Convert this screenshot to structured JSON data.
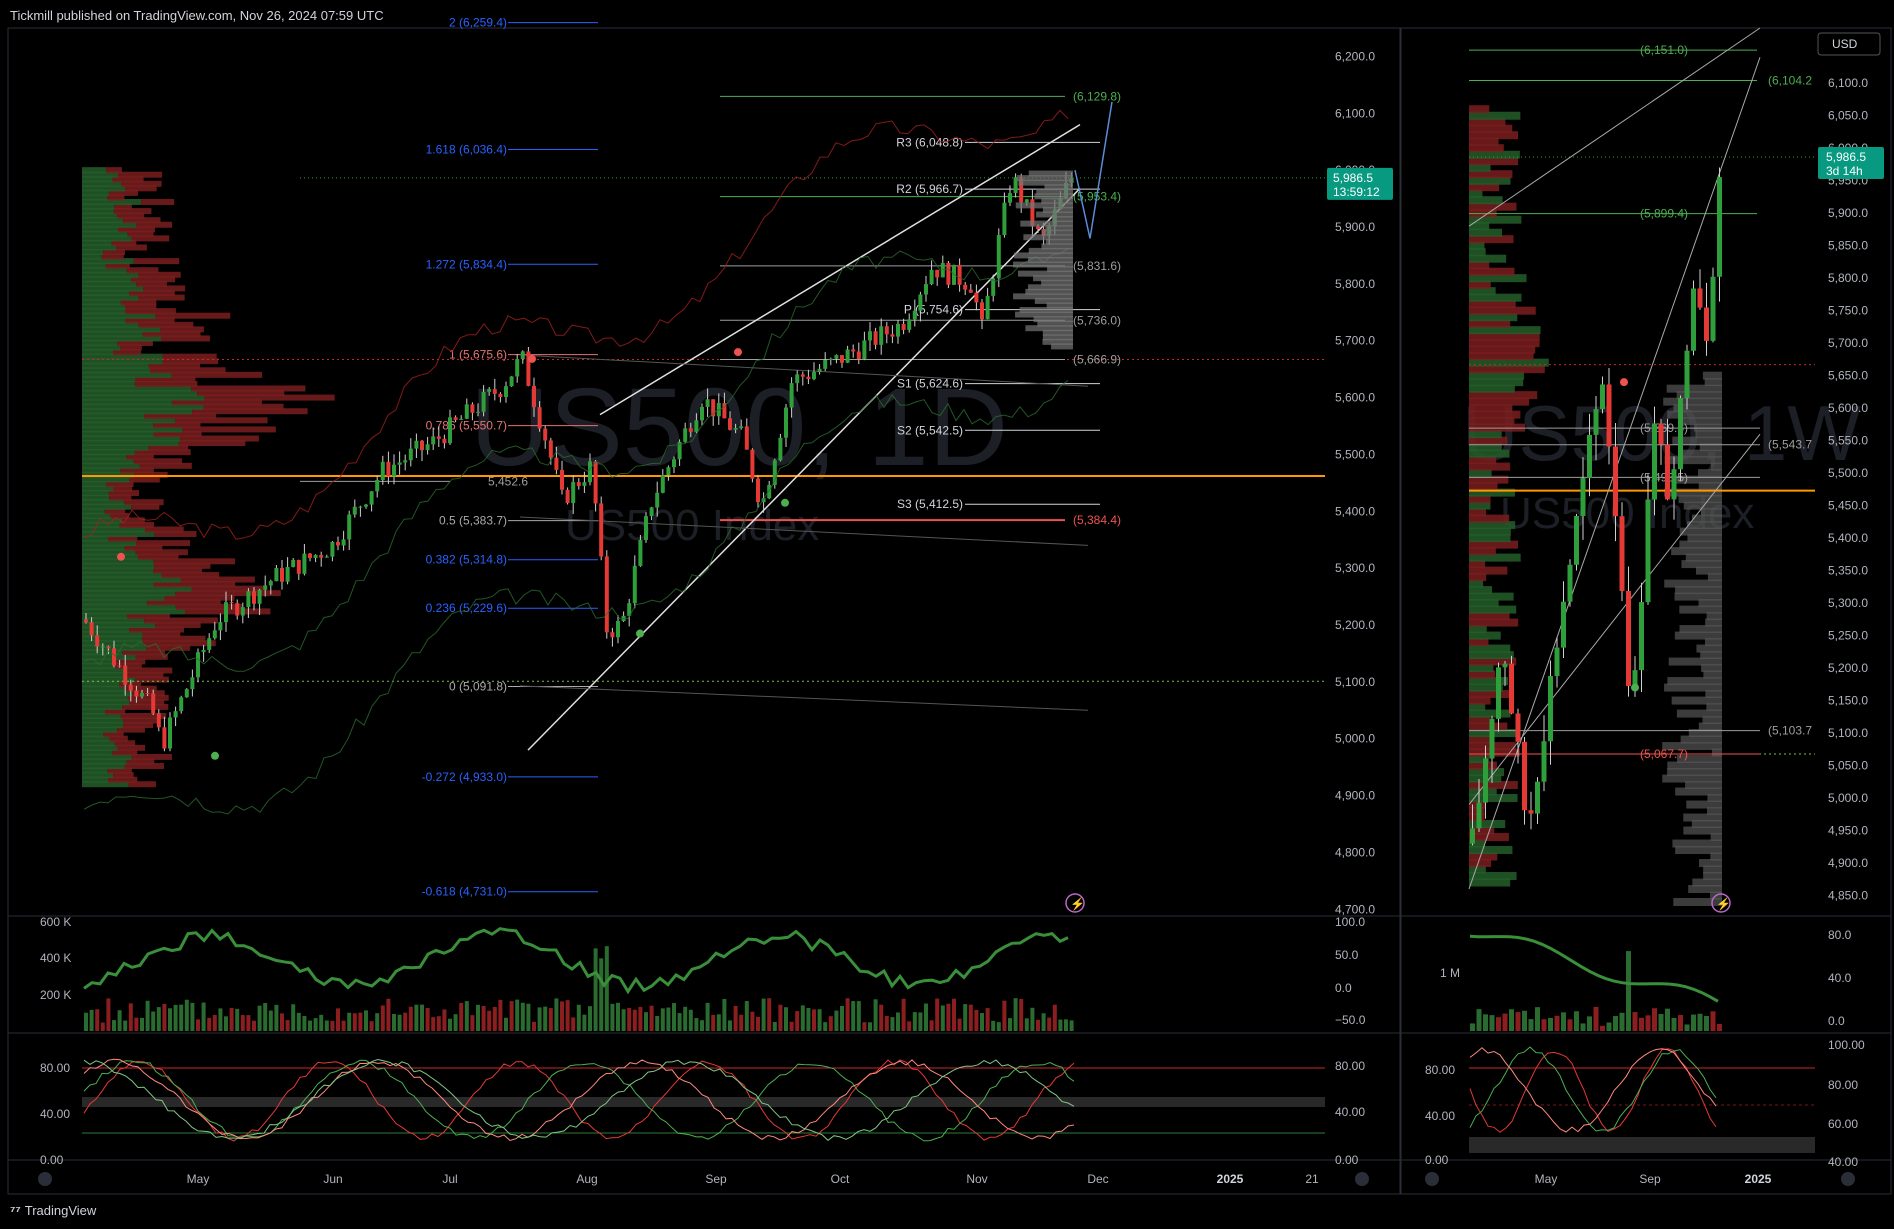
{
  "header": {
    "published": "Tickmill published on TradingView.com, Nov 26, 2024 07:59 UTC"
  },
  "footer": {
    "logo_text": "TradingView"
  },
  "colors": {
    "bull": "#2e9f3a",
    "bear": "#c62828",
    "fib": "#2962ff",
    "orange": "#ff9800",
    "panel_line": "#2a2e39",
    "price_badge": "#089981"
  },
  "chart_data": [
    {
      "type": "line",
      "name": "daily",
      "watermark_symbol": "US500, 1D",
      "watermark_desc": "US500 Index",
      "price_axis_ticks": [
        "6,200.0",
        "6,100.0",
        "6,000.0",
        "5,900.0",
        "5,800.0",
        "5,700.0",
        "5,600.0",
        "5,500.0",
        "5,400.0",
        "5,300.0",
        "5,200.0",
        "5,100.0",
        "5,000.0",
        "4,900.0",
        "4,800.0",
        "4,700.0"
      ],
      "ylim": [
        4690,
        6250
      ],
      "price_tag": {
        "value": "5,986.5",
        "timer": "13:59:12"
      },
      "time_axis_labels": [
        "May",
        "Jun",
        "Jul",
        "Aug",
        "Sep",
        "Oct",
        "Nov",
        "Dec",
        "2025",
        "21"
      ],
      "fib_levels": [
        {
          "label": "2 (6,259.4)",
          "price": 6259.4
        },
        {
          "label": "1.618 (6,036.4)",
          "price": 6036.4
        },
        {
          "label": "1.272 (5,834.4)",
          "price": 5834.4
        },
        {
          "label": "1 (5,675.6)",
          "price": 5675.6
        },
        {
          "label": "0.786 (5,550.7)",
          "price": 5550.7
        },
        {
          "label": "0.5 (5,383.7)",
          "price": 5383.7
        },
        {
          "label": "0.382 (5,314.8)",
          "price": 5314.8
        },
        {
          "label": "0.236 (5,229.6)",
          "price": 5229.6
        },
        {
          "label": "0 (5,091.8)",
          "price": 5091.8
        },
        {
          "label": "-0.272 (4,933.0)",
          "price": 4933.0
        },
        {
          "label": "-0.618 (4,731.0)",
          "price": 4731.0
        }
      ],
      "pivots": [
        {
          "label": "R3 (6,048.8)",
          "price": 6048.8
        },
        {
          "label": "R2 (5,966.7)",
          "price": 5966.7
        },
        {
          "label": "P (5,754.6)",
          "price": 5754.6
        },
        {
          "label": "S1 (5,624.6)",
          "price": 5624.6
        },
        {
          "label": "S2 (5,542.5)",
          "price": 5542.5
        },
        {
          "label": "S3 (5,412.5)",
          "price": 5412.5
        }
      ],
      "levels_right": [
        {
          "label": "(6,129.8)",
          "price": 6129.8
        },
        {
          "label": "(5,953.4)",
          "price": 5953.4
        },
        {
          "label": "(5,831.6)",
          "price": 5831.6
        },
        {
          "label": "(5,736.0)",
          "price": 5736.0
        },
        {
          "label": "(5,666.9)",
          "price": 5666.9
        },
        {
          "label": "(5,384.4)",
          "price": 5384.4
        },
        {
          "label": "5,452.6",
          "price": 5452.6
        }
      ],
      "volume_axis": [
        "600 K",
        "400 K",
        "200 K"
      ],
      "osc_axis_right": [
        "100.0",
        "50.0",
        "0.0",
        "−50.0"
      ],
      "stoch_axis_left": [
        "80.00",
        "40.00",
        "0.00"
      ],
      "stoch_axis_right": [
        "80.00",
        "40.00",
        "0.00"
      ]
    },
    {
      "type": "line",
      "name": "weekly",
      "watermark_symbol": "US500, 1W",
      "watermark_desc": "US500 Index",
      "currency": "USD",
      "price_axis_ticks": [
        "6,100.0",
        "6,050.0",
        "6,000.0",
        "5,950.0",
        "5,900.0",
        "5,850.0",
        "5,800.0",
        "5,750.0",
        "5,700.0",
        "5,650.0",
        "5,600.0",
        "5,550.0",
        "5,500.0",
        "5,450.0",
        "5,400.0",
        "5,350.0",
        "5,300.0",
        "5,250.0",
        "5,200.0",
        "5,150.0",
        "5,100.0",
        "5,050.0",
        "5,000.0",
        "4,950.0",
        "4,900.0",
        "4,850.0"
      ],
      "ylim": [
        4820,
        6185
      ],
      "price_tag": {
        "value": "5,986.5",
        "timer": "3d 14h"
      },
      "time_axis_labels": [
        "May",
        "Sep",
        "2025"
      ],
      "levels": [
        {
          "label": "(6,151.0)",
          "price": 6151.0
        },
        {
          "label": "(6,104.2",
          "price": 6104.2
        },
        {
          "label": "(5,899.4)",
          "price": 5899.4
        },
        {
          "label": "(5,543.7",
          "price": 5543.7
        },
        {
          "label": "(5,103.7",
          "price": 5103.7
        },
        {
          "label": "(5,067.7)",
          "price": 5067.7
        },
        {
          "label": "(5,569.3)",
          "price": 5569.3
        },
        {
          "label": "(5,493.5)",
          "price": 5493.5
        }
      ],
      "volume_axis": [
        "1 M"
      ],
      "osc_axis_right": [
        "80.0",
        "40.0",
        "0.0"
      ],
      "stoch_axis_left": [
        "80.00",
        "40.00",
        "0.00"
      ],
      "stoch_axis_right": [
        "100.00",
        "80.00",
        "60.00",
        "40.00"
      ]
    }
  ]
}
